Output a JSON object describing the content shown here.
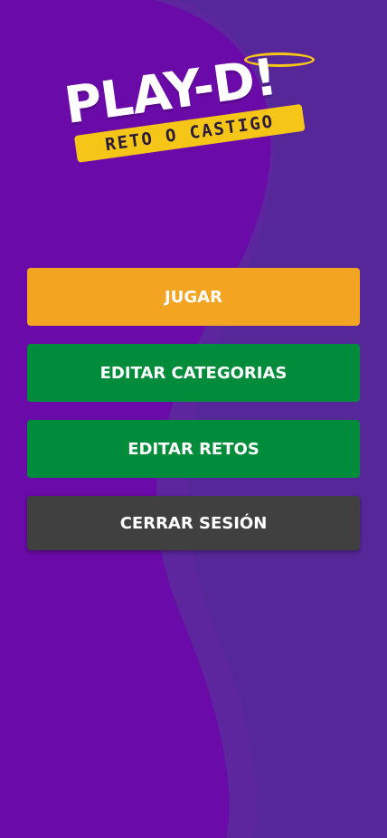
{
  "logo": {
    "title": "PLAY-D!",
    "subtitle": "RETO O CASTIGO"
  },
  "menu": {
    "play_label": "JUGAR",
    "edit_categories_label": "EDITAR CATEGORIAS",
    "edit_challenges_label": "EDITAR RETOS",
    "logout_label": "CERRAR SESIÓN"
  },
  "colors": {
    "background": "#6a0aa8",
    "background_wave": "#4f2a95",
    "play_button": "#f3a421",
    "green_button": "#008c3a",
    "dark_button": "#404040",
    "logo_accent": "#f5c518"
  }
}
